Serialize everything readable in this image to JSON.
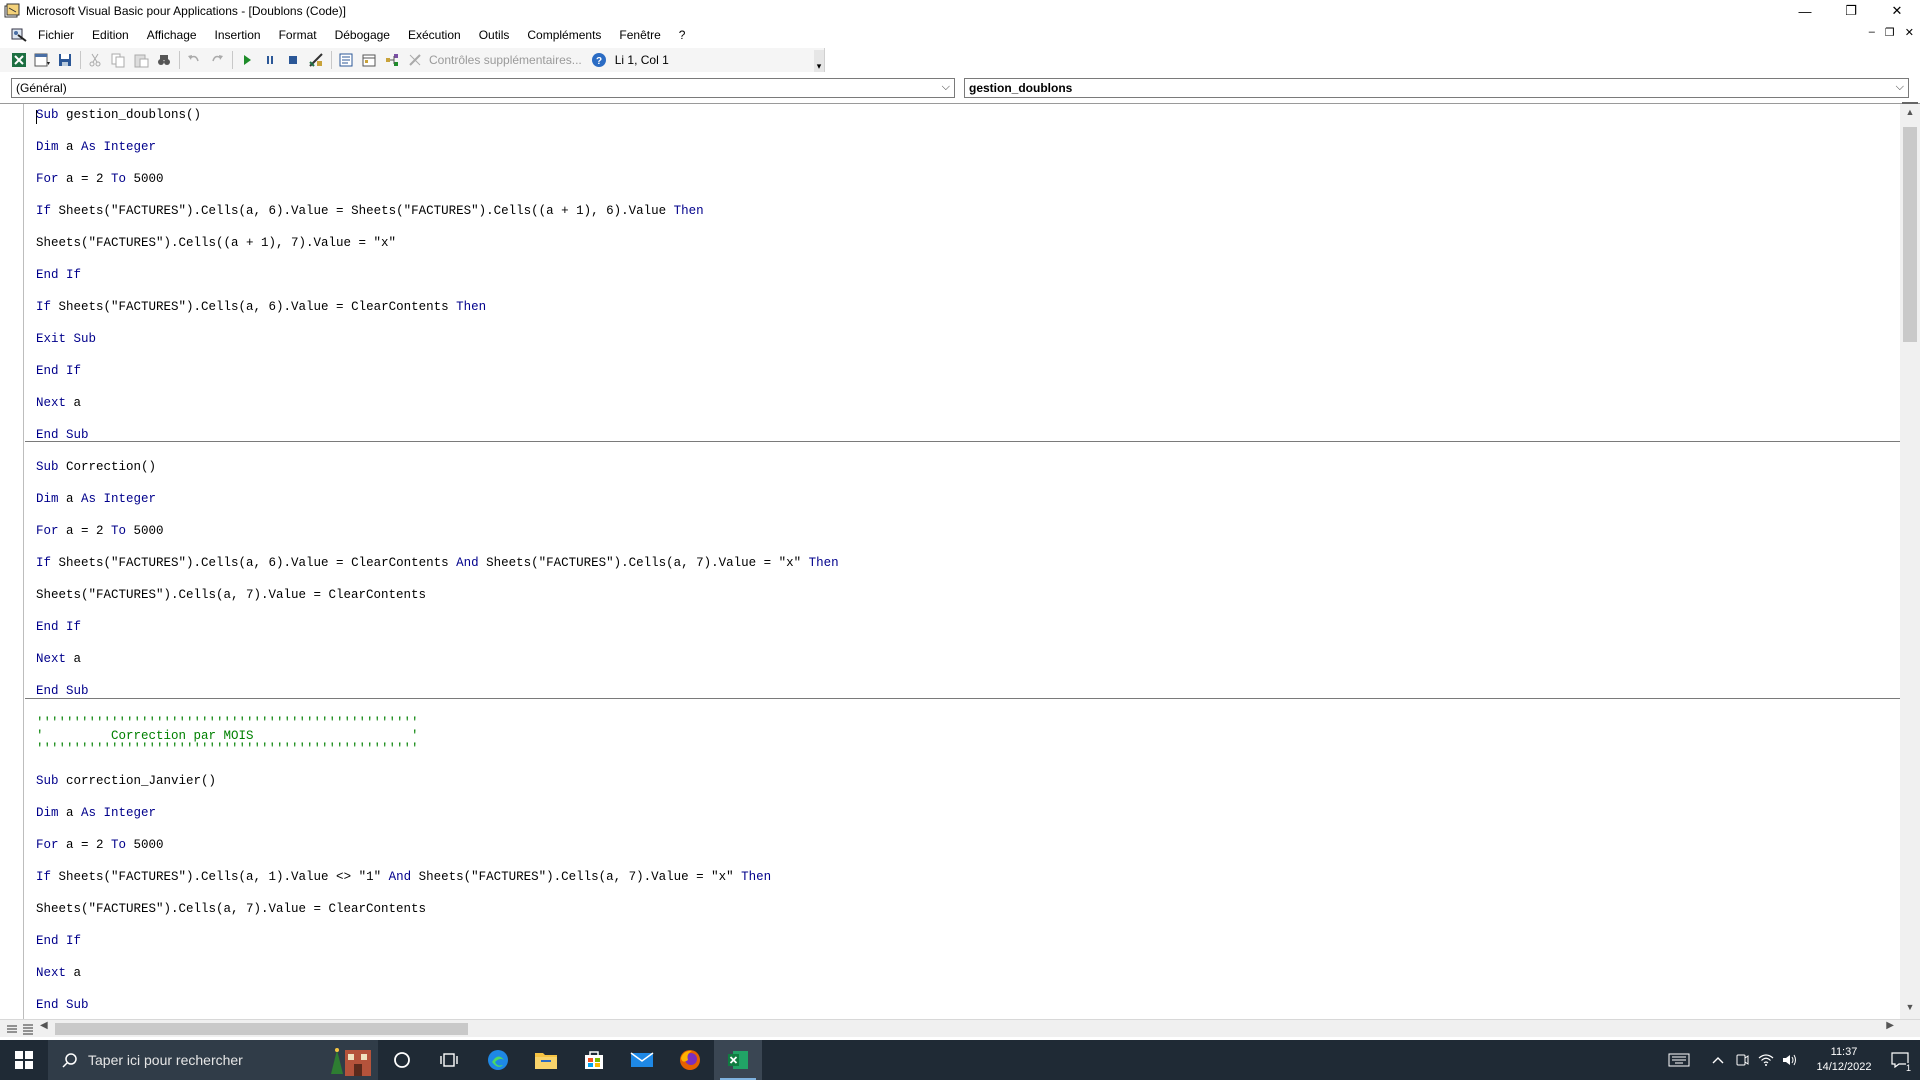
{
  "window": {
    "title": "Microsoft Visual Basic pour Applications - [Doublons (Code)]",
    "controls": {
      "minimize": "—",
      "restore": "❐",
      "close": "✕"
    },
    "mdi_controls": {
      "minimize": "‒",
      "restore": "❐",
      "close": "✕"
    }
  },
  "menu": {
    "items": [
      "Fichier",
      "Edition",
      "Affichage",
      "Insertion",
      "Format",
      "Débogage",
      "Exécution",
      "Outils",
      "Compléments",
      "Fenêtre",
      "?"
    ]
  },
  "toolbar": {
    "extra_controls_label": "Contrôles supplémentaires...",
    "cursor_status": "Li 1, Col 1",
    "overflow_glyph": "▾"
  },
  "selectors": {
    "object": "(Général)",
    "procedure": "gestion_doublons",
    "arrow": "⌵"
  },
  "code": {
    "lines": [
      [
        [
          "kw",
          "Sub"
        ],
        [
          "plain",
          " gestion_doublons()"
        ]
      ],
      [
        [
          "kw",
          "Dim"
        ],
        [
          "plain",
          " a "
        ],
        [
          "kw",
          "As Integer"
        ]
      ],
      [
        [
          "kw",
          "For"
        ],
        [
          "plain",
          " a = 2 "
        ],
        [
          "kw",
          "To"
        ],
        [
          "plain",
          " 5000"
        ]
      ],
      [
        [
          "kw",
          "If"
        ],
        [
          "plain",
          " Sheets(\"FACTURES\").Cells(a, 6).Value = Sheets(\"FACTURES\").Cells((a + 1), 6).Value "
        ],
        [
          "kw",
          "Then"
        ]
      ],
      [
        [
          "plain",
          "Sheets(\"FACTURES\").Cells((a + 1), 7).Value = \"x\""
        ]
      ],
      [
        [
          "kw",
          "End If"
        ]
      ],
      [
        [
          "kw",
          "If"
        ],
        [
          "plain",
          " Sheets(\"FACTURES\").Cells(a, 6).Value = ClearContents "
        ],
        [
          "kw",
          "Then"
        ]
      ],
      [
        [
          "kw",
          "Exit Sub"
        ]
      ],
      [
        [
          "kw",
          "End If"
        ]
      ],
      [
        [
          "kw",
          "Next"
        ],
        [
          "plain",
          " a"
        ]
      ],
      [
        [
          "kw",
          "End Sub"
        ]
      ],
      [
        [
          "kw",
          "Sub"
        ],
        [
          "plain",
          " Correction()"
        ]
      ],
      [
        [
          "kw",
          "Dim"
        ],
        [
          "plain",
          " a "
        ],
        [
          "kw",
          "As Integer"
        ]
      ],
      [
        [
          "kw",
          "For"
        ],
        [
          "plain",
          " a = 2 "
        ],
        [
          "kw",
          "To"
        ],
        [
          "plain",
          " 5000"
        ]
      ],
      [
        [
          "kw",
          "If"
        ],
        [
          "plain",
          " Sheets(\"FACTURES\").Cells(a, 6).Value = ClearContents "
        ],
        [
          "kw",
          "And"
        ],
        [
          "plain",
          " Sheets(\"FACTURES\").Cells(a, 7).Value = \"x\" "
        ],
        [
          "kw",
          "Then"
        ]
      ],
      [
        [
          "plain",
          "Sheets(\"FACTURES\").Cells(a, 7).Value = ClearContents"
        ]
      ],
      [
        [
          "kw",
          "End If"
        ]
      ],
      [
        [
          "kw",
          "Next"
        ],
        [
          "plain",
          " a"
        ]
      ],
      [
        [
          "kw",
          "End Sub"
        ]
      ],
      [
        [
          "cm",
          "'''''''''''''''''''''''''''''''''''''''''''''''''''"
        ]
      ],
      [
        [
          "cm",
          "'         Correction par MOIS                     '"
        ]
      ],
      [
        [
          "cm",
          "'''''''''''''''''''''''''''''''''''''''''''''''''''"
        ]
      ],
      [
        [
          "kw",
          "Sub"
        ],
        [
          "plain",
          " correction_Janvier()"
        ]
      ],
      [
        [
          "kw",
          "Dim"
        ],
        [
          "plain",
          " a "
        ],
        [
          "kw",
          "As Integer"
        ]
      ],
      [
        [
          "kw",
          "For"
        ],
        [
          "plain",
          " a = 2 "
        ],
        [
          "kw",
          "To"
        ],
        [
          "plain",
          " 5000"
        ]
      ],
      [
        [
          "kw",
          "If"
        ],
        [
          "plain",
          " Sheets(\"FACTURES\").Cells(a, 1).Value <> \"1\" "
        ],
        [
          "kw",
          "And"
        ],
        [
          "plain",
          " Sheets(\"FACTURES\").Cells(a, 7).Value = \"x\" "
        ],
        [
          "kw",
          "Then"
        ]
      ],
      [
        [
          "plain",
          "Sheets(\"FACTURES\").Cells(a, 7).Value = ClearContents"
        ]
      ],
      [
        [
          "kw",
          "End If"
        ]
      ],
      [
        [
          "kw",
          "Next"
        ],
        [
          "plain",
          " a"
        ]
      ],
      [
        [
          "kw",
          "End Sub"
        ]
      ]
    ]
  },
  "scrollbars": {
    "up": "▲",
    "down": "▼",
    "left": "◀",
    "right": "▶"
  },
  "taskbar": {
    "search_placeholder": "Taper ici pour rechercher",
    "time": "11:37",
    "date": "14/12/2022",
    "notification_count": "1"
  },
  "colors": {
    "keyword": "#00008b",
    "comment": "#008000",
    "taskbar": "#1f2a35"
  }
}
